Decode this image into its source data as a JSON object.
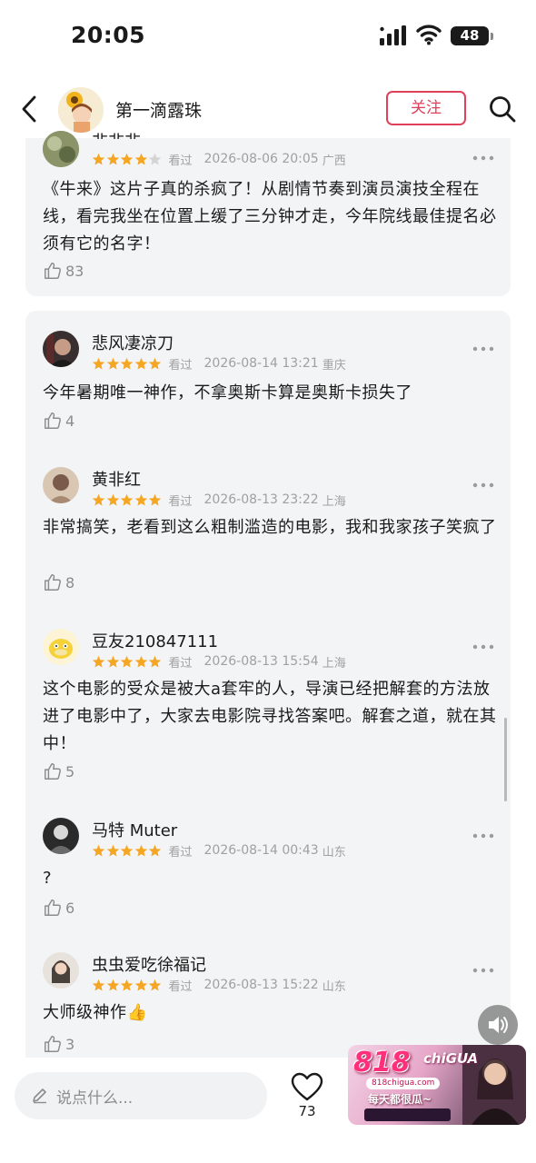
{
  "status_bar": {
    "time": "20:05",
    "battery": "48"
  },
  "header": {
    "user_name": "第一滴露珠",
    "follow_label": "关注"
  },
  "seen_label": "看过",
  "reviews": [
    {
      "author": "非非非",
      "stars": 4,
      "datetime": "2026-08-06 20:05",
      "location": "广西",
      "text": "《牛来》这片子真的杀疯了！从剧情节奏到演员演技全程在线，看完我坐在位置上缓了三分钟才走，今年院线最佳提名必须有它的名字！",
      "likes": "83"
    },
    {
      "author": "悲风凄凉刀",
      "stars": 5,
      "datetime": "2026-08-14 13:21",
      "location": "重庆",
      "text": "今年暑期唯一神作，不拿奥斯卡算是奥斯卡损失了",
      "likes": "4"
    },
    {
      "author": "黄非红",
      "stars": 5,
      "datetime": "2026-08-13 23:22",
      "location": "上海",
      "text": "非常搞笑，老看到这么粗制滥造的电影，我和我家孩子笑疯了",
      "likes": "8"
    },
    {
      "author": "豆友210847111",
      "stars": 5,
      "datetime": "2026-08-13 15:54",
      "location": "上海",
      "text": "这个电影的受众是被大a套牢的人，导演已经把解套的方法放进了电影中了，大家去电影院寻找答案吧。解套之道，就在其中！",
      "likes": "5"
    },
    {
      "author": "马特 Muter",
      "stars": 5,
      "datetime": "2026-08-14 00:43",
      "location": "山东",
      "text": "?",
      "likes": "6"
    },
    {
      "author": "虫虫爱吃徐福记",
      "stars": 5,
      "datetime": "2026-08-13 15:22",
      "location": "山东",
      "text": "大师级神作👍",
      "likes": "3"
    }
  ],
  "composer": {
    "placeholder": "说点什么..."
  },
  "heart": {
    "count": "73"
  },
  "ad": {
    "logo": "818",
    "brand": "chiGUA",
    "domain": "818chigua.com",
    "slogan": "每天都很瓜~"
  },
  "colors": {
    "accent": "#e0405a",
    "star": "#f5a623",
    "card_bg": "#f3f4f5"
  }
}
